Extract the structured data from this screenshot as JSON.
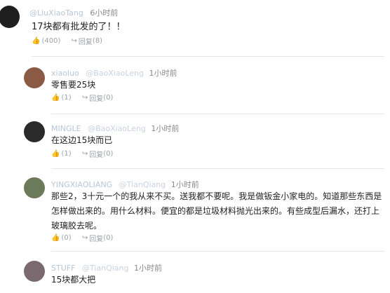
{
  "comments": [
    {
      "user": "@LiuXiaoTang",
      "handle": "",
      "time": "6小时前",
      "text": "17块都有批发的了！！",
      "likes": "(400)",
      "reply_label": "回复",
      "replies": "(8)",
      "avatar_color": "#1f1f1f"
    },
    {
      "user": "xiaoluo",
      "handle": "@BaoXiaoLeng",
      "time": "1小时前",
      "text": "零售要25块",
      "likes": "(1)",
      "reply_label": "回复",
      "replies": "(0)",
      "avatar_color": "#8a5a44"
    },
    {
      "user": "MINGLE",
      "handle": "@BaoXiaoLeng",
      "time": "1小时前",
      "text": "在这边15块而已",
      "likes": "(1)",
      "reply_label": "回复",
      "replies": "(0)",
      "avatar_color": "#2a2a2a"
    },
    {
      "user": "YINGXIAOLIANG",
      "handle": "@TianQiang",
      "time": "1小时前",
      "text": "那些2，3十元一个的我从来不买。送我都不要呢。我是做钣金小家电的。知道那些东西是怎样做出来的。用什么材料。便宜的都是垃圾材料抛光出来的。有些成型后漏水，还打上玻璃胶去呢。",
      "likes": "(0)",
      "reply_label": "回复",
      "replies": "(0)",
      "avatar_color": "#6b7a5a"
    },
    {
      "user": "STUFF",
      "handle": "@TianQiang",
      "time": "1小时前",
      "text": "15块都大把",
      "likes": "(0)",
      "reply_label": "回复",
      "replies": "(0)",
      "avatar_color": "#7a6a70"
    }
  ]
}
